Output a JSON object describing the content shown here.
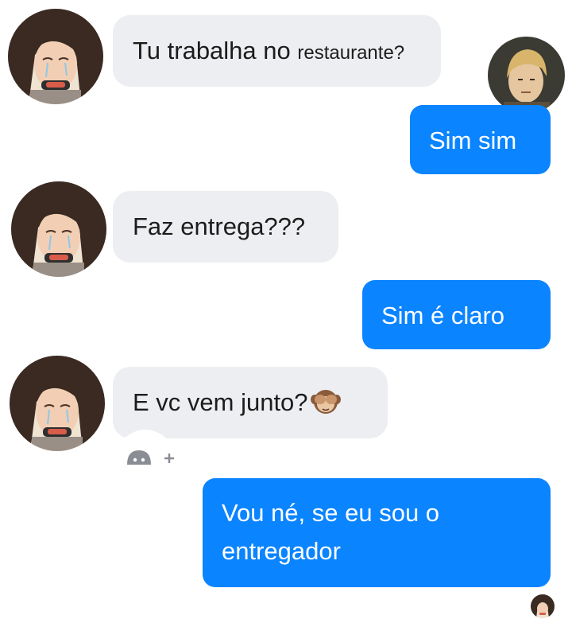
{
  "messages": [
    {
      "id": "m1",
      "direction": "incoming",
      "text": "Tu trabalha no",
      "text_small": "restaurante?"
    },
    {
      "id": "m2",
      "direction": "outgoing",
      "text": "Sim sim"
    },
    {
      "id": "m3",
      "direction": "incoming",
      "text": "Faz entrega???"
    },
    {
      "id": "m4",
      "direction": "outgoing",
      "text": "Sim é  claro"
    },
    {
      "id": "m5",
      "direction": "incoming",
      "text": "E vc vem junto?",
      "emoji": "see-no-evil-monkey-emoji"
    },
    {
      "id": "m6",
      "direction": "outgoing",
      "text_line1": "Vou né, se eu sou o",
      "text_line2": "entregador"
    }
  ],
  "reaction_button": {
    "icon": "add-reaction-icon",
    "plus": "+"
  },
  "colors": {
    "outgoing_bubble": "#0a84ff",
    "incoming_bubble": "#edeef1",
    "incoming_text": "#1c1c1c",
    "outgoing_text": "#ffffff"
  }
}
